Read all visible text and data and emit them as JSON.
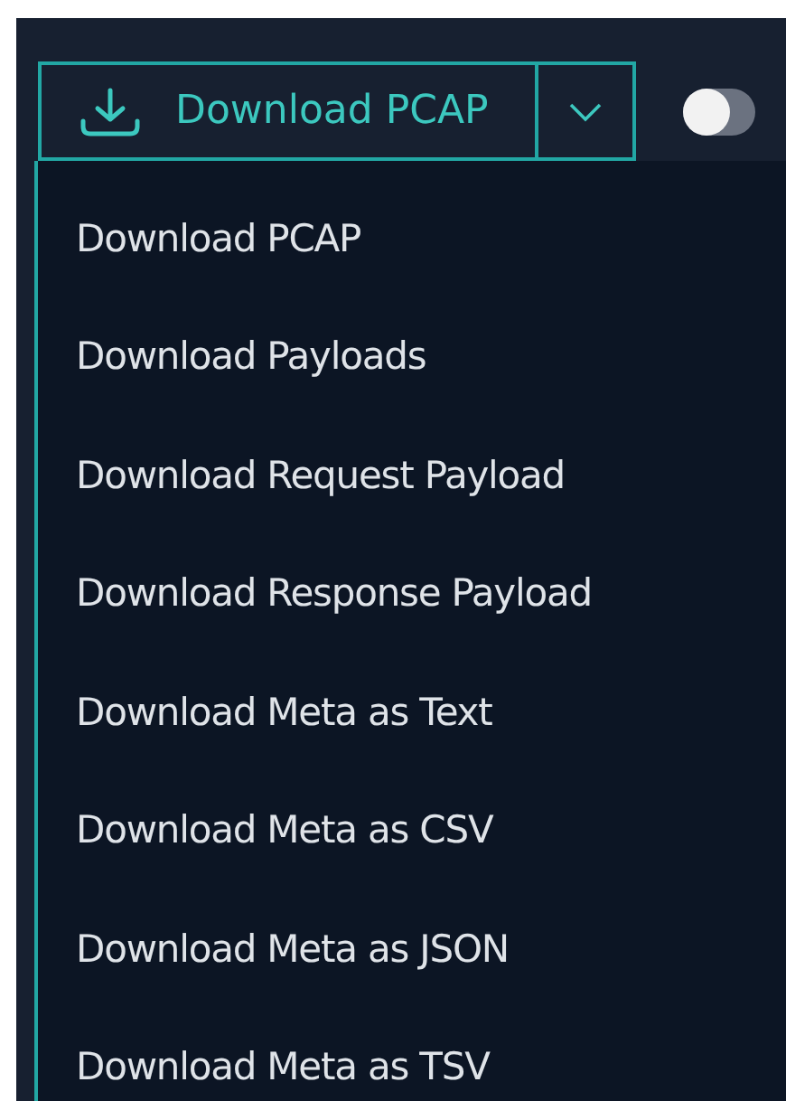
{
  "download_button": {
    "label": "Download PCAP"
  },
  "toggle": {
    "on": false
  },
  "menu": {
    "items": [
      {
        "label": "Download PCAP"
      },
      {
        "label": "Download Payloads"
      },
      {
        "label": "Download Request Payload"
      },
      {
        "label": "Download Response Payload"
      },
      {
        "label": "Download Meta as Text"
      },
      {
        "label": "Download Meta as CSV"
      },
      {
        "label": "Download Meta as JSON"
      },
      {
        "label": "Download Meta as TSV"
      }
    ]
  }
}
